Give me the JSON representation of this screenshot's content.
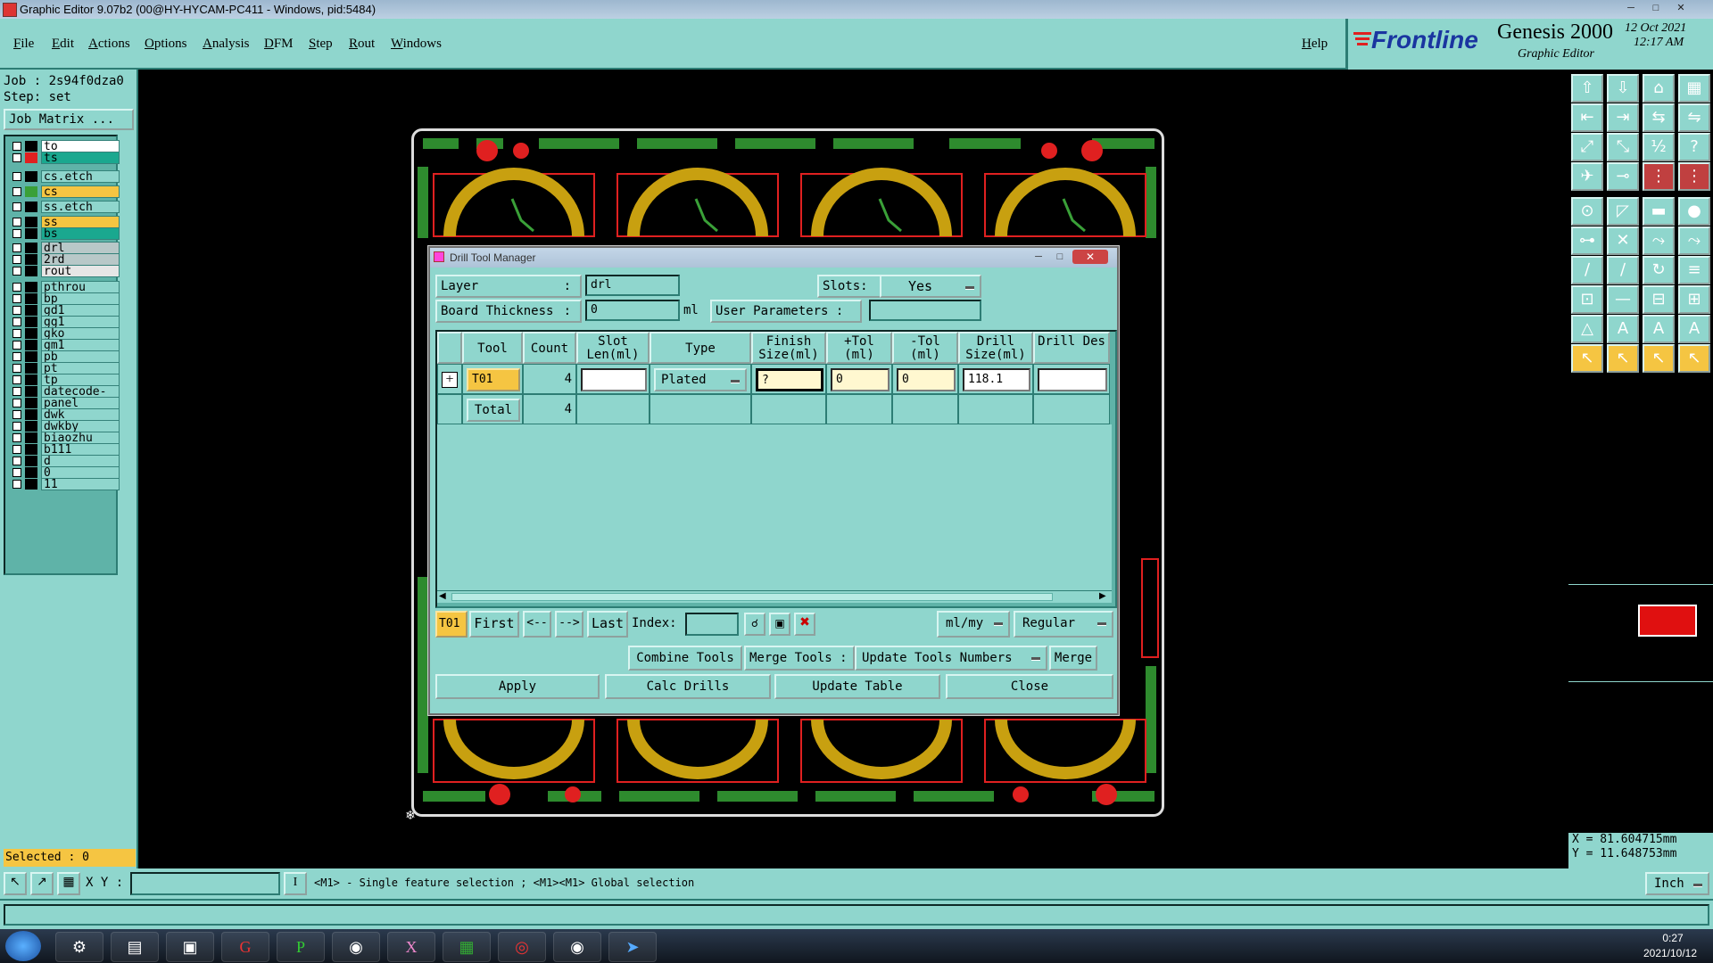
{
  "window": {
    "title": "Graphic Editor 9.07b2 (00@HY-HYCAM-PC411 - Windows, pid:5484)"
  },
  "menu": [
    "File",
    "Edit",
    "Actions",
    "Options",
    "Analysis",
    "DFM",
    "Step",
    "Rout",
    "Windows"
  ],
  "help_label": "Help",
  "brand": {
    "logo": "Frontline",
    "product": "Genesis 2000",
    "subtitle": "Graphic Editor",
    "date": "12 Oct 2021",
    "time": "12:17 AM"
  },
  "job": {
    "job_line": "Job : 2s94f0dza0",
    "step_line": "Step: set",
    "matrix_button": "Job Matrix ..."
  },
  "layers": [
    {
      "name": "to",
      "color": "#ffffff",
      "swatch": "#000000"
    },
    {
      "name": "ts",
      "color": "#1aa88f",
      "swatch": "#e02020"
    },
    {
      "name": "cs.etch",
      "color": "#8fd6cd",
      "swatch": "#000000"
    },
    {
      "name": "cs",
      "color": "#f5c542",
      "swatch": "#3aa038"
    },
    {
      "name": "ss.etch",
      "color": "#8fd6cd",
      "swatch": "#000000"
    },
    {
      "name": "ss",
      "color": "#f5c542",
      "swatch": "#000000"
    },
    {
      "name": "bs",
      "color": "#1aa88f",
      "swatch": "#000000"
    },
    {
      "name": "drl",
      "color": "#b8c8c8",
      "swatch": "#000000"
    },
    {
      "name": "2rd",
      "color": "#b8c8c8",
      "swatch": "#000000"
    },
    {
      "name": "rout",
      "color": "#e6e6e6",
      "swatch": "#000000"
    },
    {
      "name": "pthrou",
      "color": "#8fd6cd",
      "swatch": "#000000"
    },
    {
      "name": "bp",
      "color": "#8fd6cd",
      "swatch": "#000000"
    },
    {
      "name": "gd1",
      "color": "#8fd6cd",
      "swatch": "#000000"
    },
    {
      "name": "gg1",
      "color": "#8fd6cd",
      "swatch": "#000000"
    },
    {
      "name": "gko",
      "color": "#8fd6cd",
      "swatch": "#000000"
    },
    {
      "name": "gm1",
      "color": "#8fd6cd",
      "swatch": "#000000"
    },
    {
      "name": "pb",
      "color": "#8fd6cd",
      "swatch": "#000000"
    },
    {
      "name": "pt",
      "color": "#8fd6cd",
      "swatch": "#000000"
    },
    {
      "name": "tp",
      "color": "#8fd6cd",
      "swatch": "#000000"
    },
    {
      "name": "datecode-to",
      "color": "#8fd6cd",
      "swatch": "#000000"
    },
    {
      "name": "panel",
      "color": "#8fd6cd",
      "swatch": "#000000"
    },
    {
      "name": "dwk",
      "color": "#8fd6cd",
      "swatch": "#000000"
    },
    {
      "name": "dwkby",
      "color": "#8fd6cd",
      "swatch": "#000000"
    },
    {
      "name": "biaozhu",
      "color": "#8fd6cd",
      "swatch": "#000000"
    },
    {
      "name": "b111",
      "color": "#8fd6cd",
      "swatch": "#000000"
    },
    {
      "name": "d",
      "color": "#8fd6cd",
      "swatch": "#000000"
    },
    {
      "name": "0",
      "color": "#8fd6cd",
      "swatch": "#000000"
    },
    {
      "name": "11",
      "color": "#8fd6cd",
      "swatch": "#000000"
    }
  ],
  "selected_label": "Selected : 0",
  "coords": {
    "x": "X = 81.604715mm",
    "y": "Y = 11.648753mm"
  },
  "status": {
    "xy_label": "X Y :",
    "hint": "<M1> - Single feature selection ; <M1><M1> Global selection",
    "units": "Inch"
  },
  "taskbar": {
    "time": "0:27",
    "date": "2021/10/12"
  },
  "dialog": {
    "title": "Drill Tool Manager",
    "layer_label": "Layer",
    "layer_value": "drl",
    "slots_label": "Slots:",
    "slots_value": "Yes",
    "thickness_label": "Board Thickness",
    "thickness_value": "0",
    "thickness_unit": "ml",
    "user_params_label": "User Parameters :",
    "user_params_value": "",
    "columns": [
      "Tool",
      "Count",
      "Slot Len(ml)",
      "Type",
      "Finish Size(ml)",
      "+Tol (ml)",
      "-Tol (ml)",
      "Drill Size(ml)",
      "Drill Des"
    ],
    "rows": [
      {
        "tool": "T01",
        "count": "4",
        "slot_len": "",
        "type": "Plated",
        "finish": "?",
        "ptol": "0",
        "mtol": "0",
        "drill": "118.1",
        "des": ""
      }
    ],
    "total_label": "Total",
    "total_count": "4",
    "nav": {
      "current": "T01",
      "first": "First",
      "prev": "<--",
      "next": "-->",
      "last": "Last",
      "index_label": "Index:",
      "index_value": "",
      "units": "ml/my",
      "mode": "Regular"
    },
    "actions": {
      "combine": "Combine Tools",
      "merge_tools": "Merge Tools :",
      "update_numbers": "Update Tools Numbers",
      "merge": "Merge",
      "apply": "Apply",
      "calc": "Calc Drills",
      "update_table": "Update Table",
      "close": "Close"
    }
  }
}
